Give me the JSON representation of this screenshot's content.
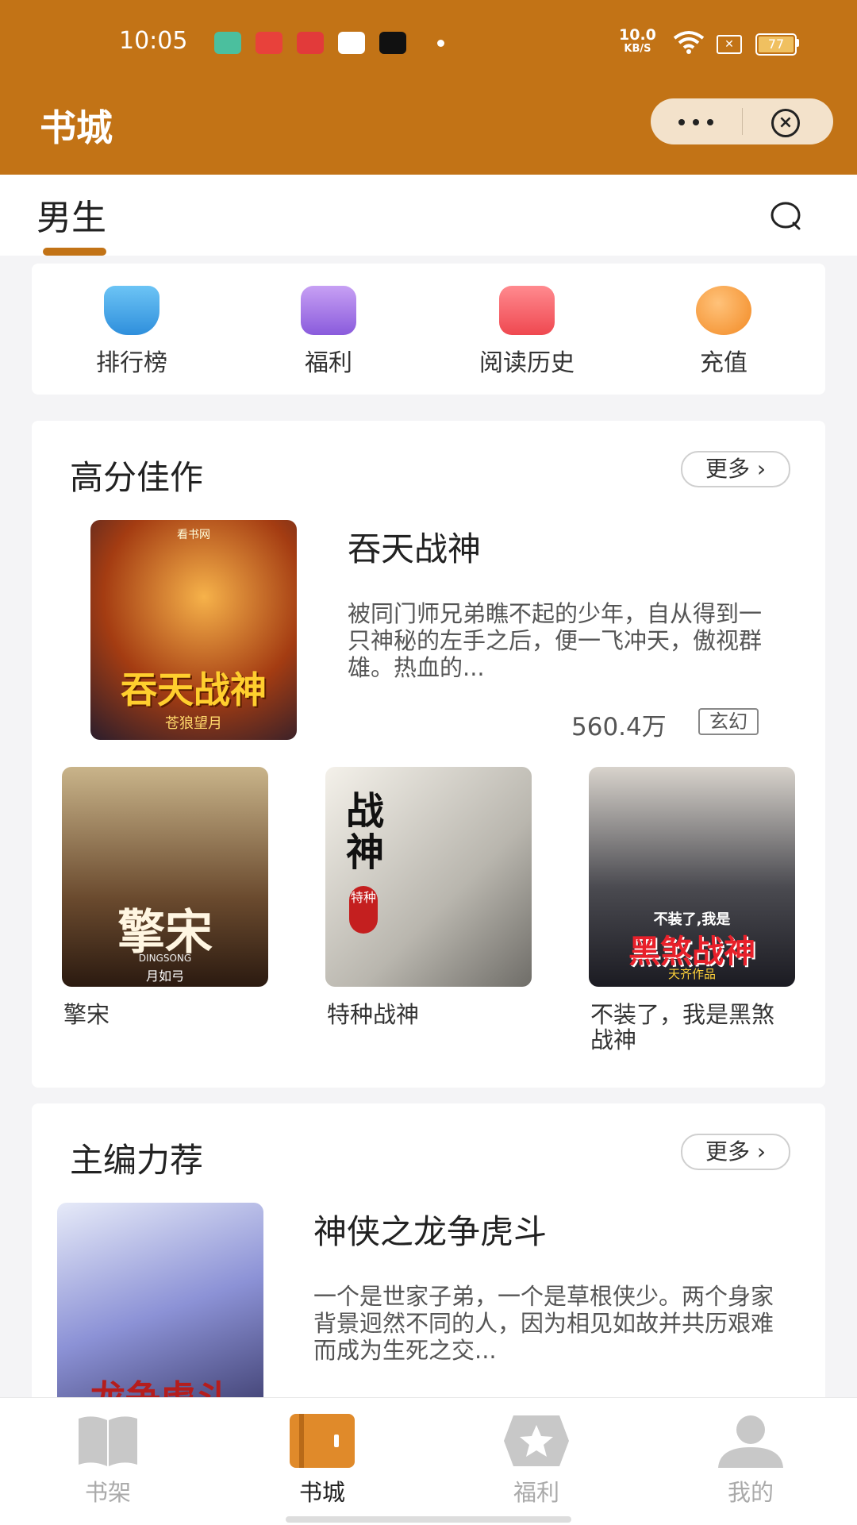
{
  "status_bar": {
    "time": "10:05",
    "net_speed_value": "10.0",
    "net_speed_unit": "KB/S",
    "battery": "77"
  },
  "header": {
    "title": "书城",
    "menu_icon": "more-dots-icon",
    "close_icon": "close-circle-icon"
  },
  "tabs": {
    "active": "男生",
    "search_icon": "search-icon"
  },
  "quick_entries": [
    {
      "label": "排行榜",
      "icon": "trophy-icon",
      "color": "#3aa0e8"
    },
    {
      "label": "福利",
      "icon": "gift-icon",
      "color": "#9b6ae0"
    },
    {
      "label": "阅读历史",
      "icon": "history-bag-icon",
      "color": "#f0505a"
    },
    {
      "label": "充值",
      "icon": "coin-icon",
      "color": "#f5962e"
    }
  ],
  "sections": [
    {
      "title": "高分佳作",
      "more": "更多",
      "featured": {
        "title": "吞天战神",
        "desc": "被同门师兄弟瞧不起的少年，自从得到一只神秘的左手之后，便一飞冲天，傲视群雄。热血的...",
        "count": "560.4万",
        "tag": "玄幻",
        "cover_text": "吞天战神",
        "cover_author": "苍狼望月",
        "cover_publisher": "看书网"
      },
      "grid": [
        {
          "title": "擎宋",
          "cover_text": "擎宋",
          "cover_sub": "DINGSONG",
          "cover_author": "月如弓"
        },
        {
          "title": "特种战神",
          "cover_text": "战神",
          "cover_sub": "特种"
        },
        {
          "title": "不装了，我是黑煞战神",
          "cover_text": "黑煞战神",
          "cover_sub": "不装了,我是",
          "cover_author": "天齐作品"
        }
      ]
    },
    {
      "title": "主编力荐",
      "more": "更多",
      "featured": {
        "title": "神侠之龙争虎斗",
        "desc": "一个是世家子弟，一个是草根侠少。两个身家背景迥然不同的人，因为相见如故并共历艰难而成为生死之交...",
        "cover_text": "龙争虎斗"
      }
    }
  ],
  "bottom_nav": [
    {
      "label": "书架",
      "icon": "bookshelf-icon",
      "active": false
    },
    {
      "label": "书城",
      "icon": "bookstore-icon",
      "active": true
    },
    {
      "label": "福利",
      "icon": "welfare-star-icon",
      "active": false
    },
    {
      "label": "我的",
      "icon": "profile-icon",
      "active": false
    }
  ],
  "colors": {
    "brand": "#c27316",
    "active_nav": "#e08a2a",
    "inactive_nav": "#c8c8c8"
  }
}
